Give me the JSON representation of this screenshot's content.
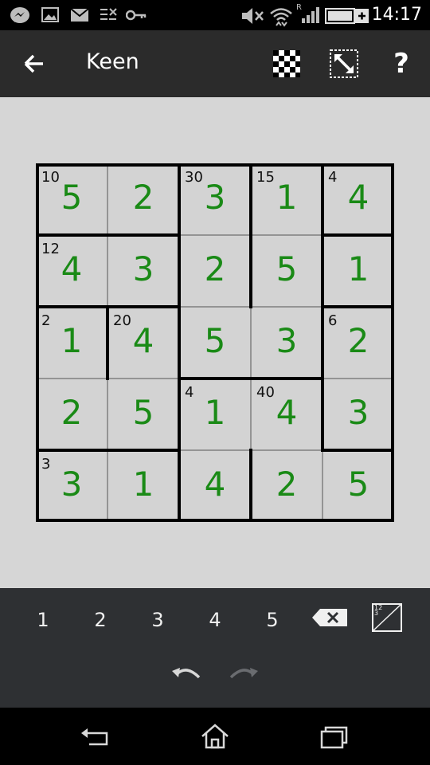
{
  "status_bar": {
    "time": "14:17",
    "icons": [
      "messenger-icon",
      "gallery-icon",
      "mail-icon",
      "data-saver-icon",
      "key-icon",
      "mute-icon",
      "wifi-icon",
      "signal-icon",
      "battery-icon"
    ],
    "roaming_label": "R"
  },
  "app": {
    "title": "Keen"
  },
  "toolbar": {
    "icons": [
      "checkerboard-icon",
      "resize-icon",
      "help-icon"
    ],
    "help_label": "?"
  },
  "puzzle": {
    "size": 5,
    "rows": [
      [
        {
          "v": "5",
          "clue": "10"
        },
        {
          "v": "2",
          "clue": ""
        },
        {
          "v": "3",
          "clue": "30"
        },
        {
          "v": "1",
          "clue": "15"
        },
        {
          "v": "4",
          "clue": "4"
        }
      ],
      [
        {
          "v": "4",
          "clue": "12"
        },
        {
          "v": "3",
          "clue": ""
        },
        {
          "v": "2",
          "clue": ""
        },
        {
          "v": "5",
          "clue": ""
        },
        {
          "v": "1",
          "clue": ""
        }
      ],
      [
        {
          "v": "1",
          "clue": "2"
        },
        {
          "v": "4",
          "clue": "20"
        },
        {
          "v": "5",
          "clue": ""
        },
        {
          "v": "3",
          "clue": ""
        },
        {
          "v": "2",
          "clue": "6"
        }
      ],
      [
        {
          "v": "2",
          "clue": ""
        },
        {
          "v": "5",
          "clue": ""
        },
        {
          "v": "1",
          "clue": "4"
        },
        {
          "v": "4",
          "clue": "40"
        },
        {
          "v": "3",
          "clue": ""
        }
      ],
      [
        {
          "v": "3",
          "clue": "3"
        },
        {
          "v": "1",
          "clue": ""
        },
        {
          "v": "4",
          "clue": ""
        },
        {
          "v": "2",
          "clue": ""
        },
        {
          "v": "5",
          "clue": ""
        }
      ]
    ],
    "value_color": "#1a8a16"
  },
  "keypad": {
    "digits": [
      "1",
      "2",
      "3",
      "4",
      "5"
    ],
    "notes_label": "12\n3"
  },
  "nav_bar": {
    "icons": [
      "back-nav-icon",
      "home-icon",
      "recents-icon"
    ]
  }
}
